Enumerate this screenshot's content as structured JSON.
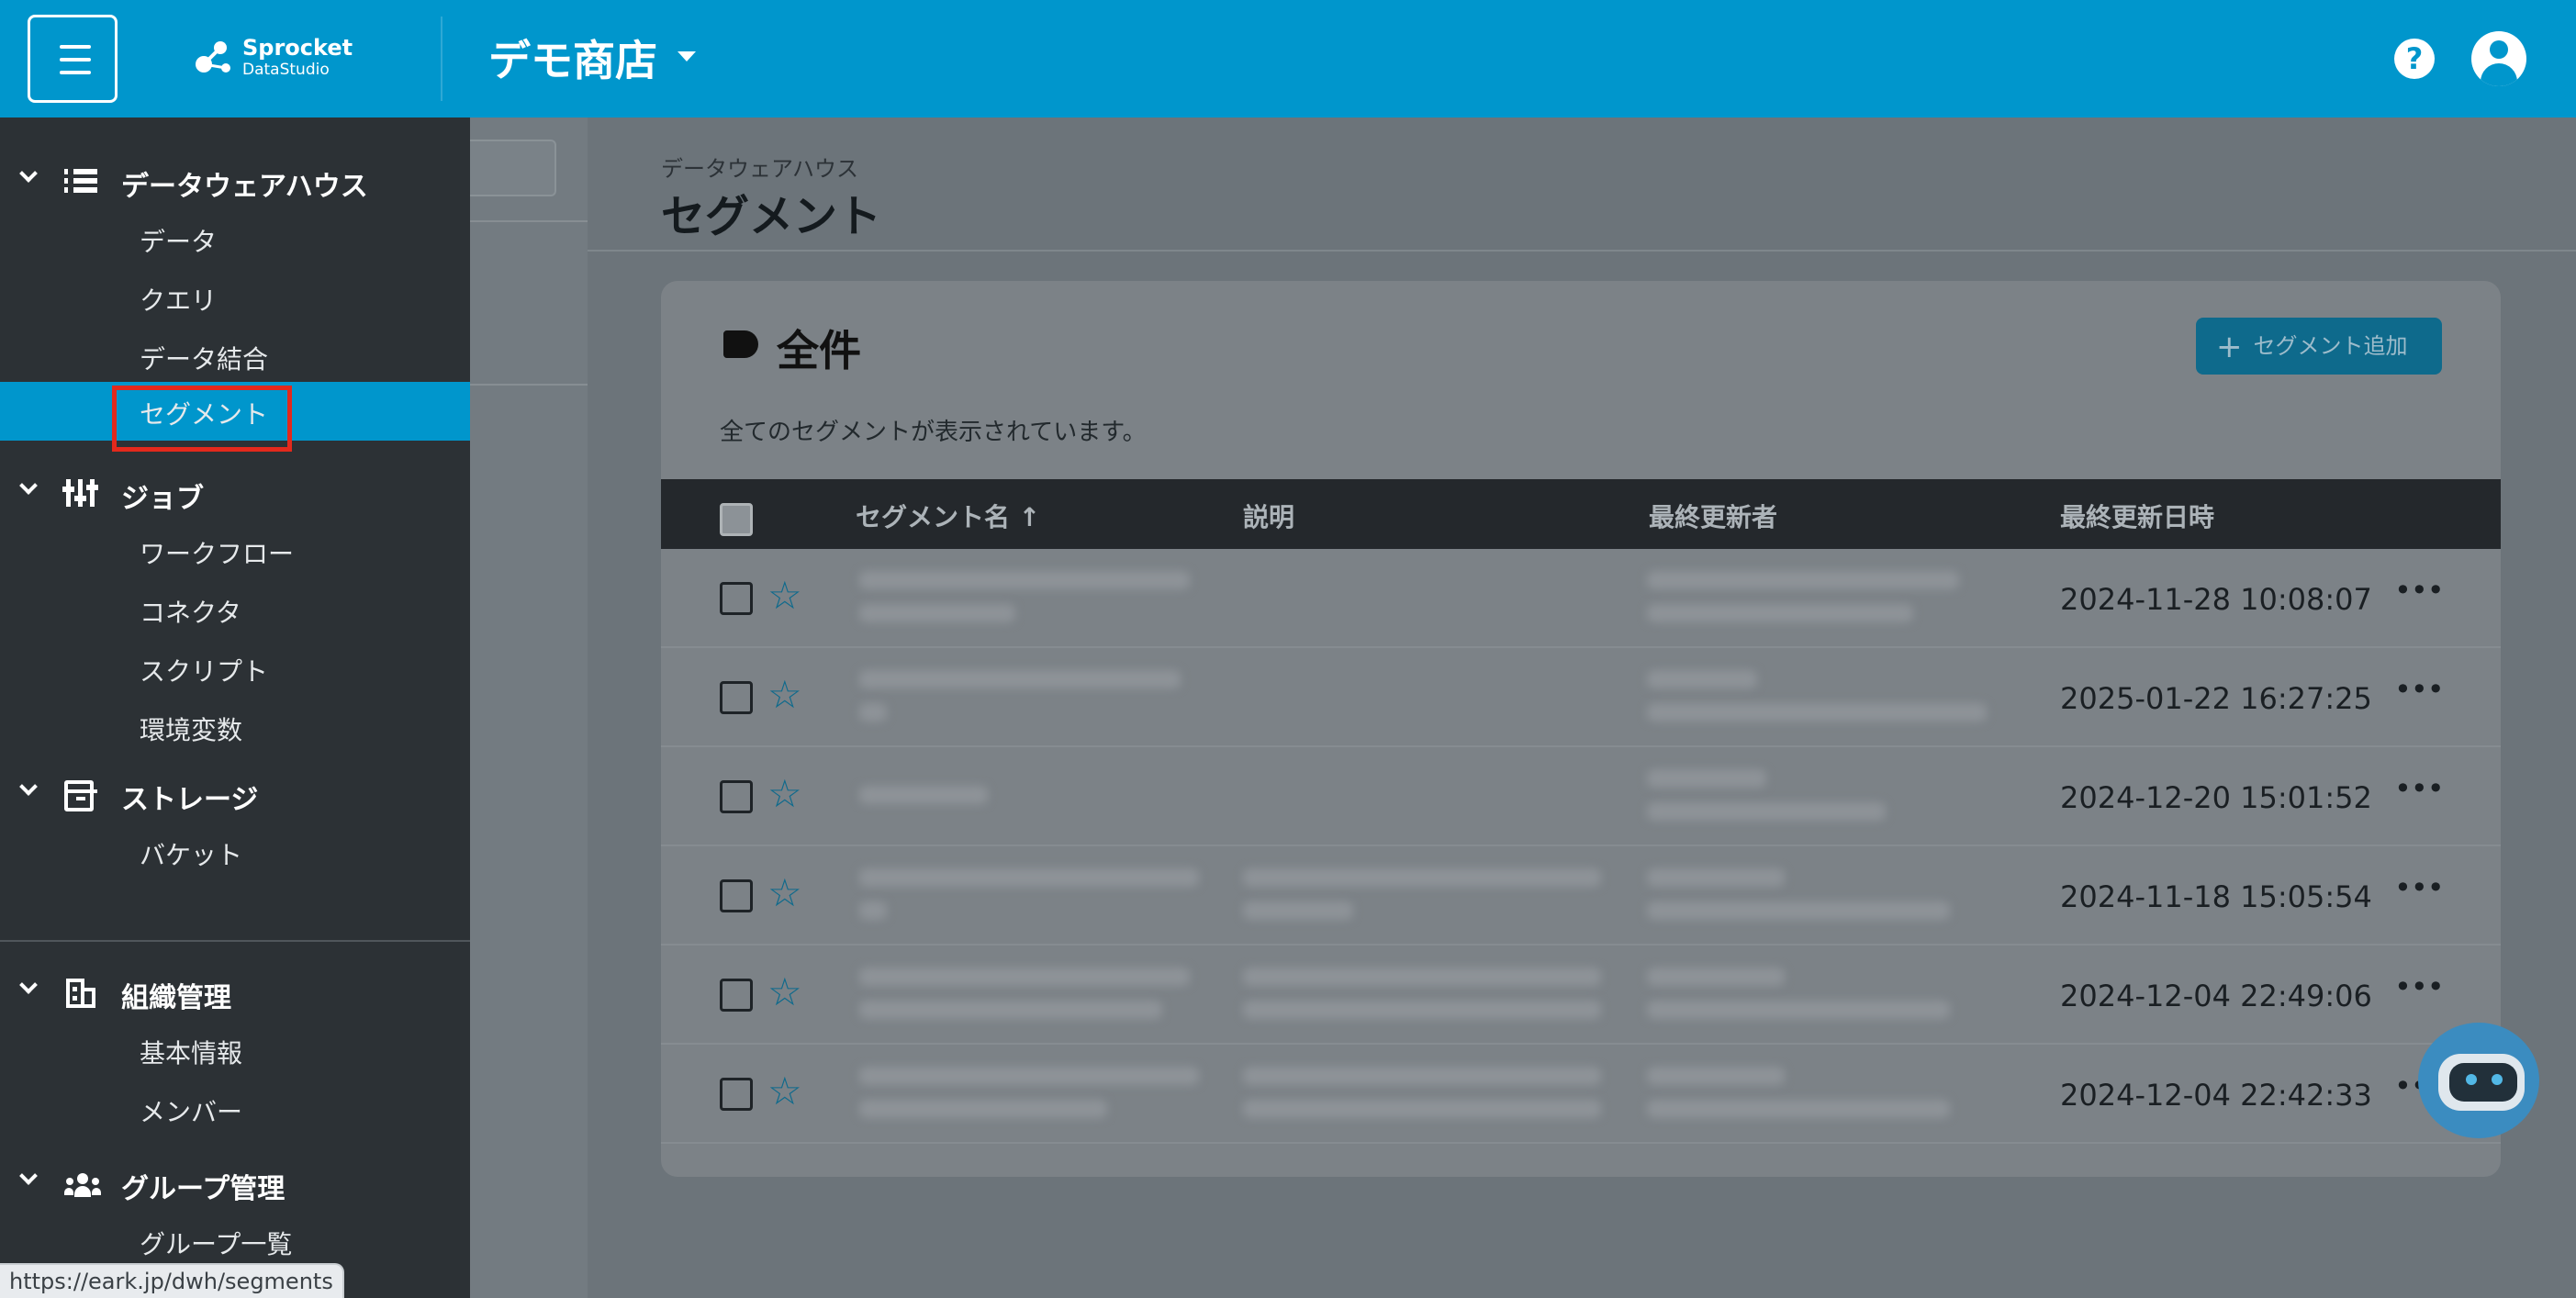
{
  "header": {
    "brand": "Sprocket",
    "brand_sub": "DataStudio",
    "shop_name": "デモ商店",
    "help_icon": "?",
    "accent_color": "#0096cc"
  },
  "sidebar": {
    "sections": [
      {
        "label": "データウェアハウス",
        "icon": "database-icon",
        "items": [
          "データ",
          "クエリ",
          "データ結合",
          "セグメント"
        ]
      },
      {
        "label": "ジョブ",
        "icon": "sliders-icon",
        "items": [
          "ワークフロー",
          "コネクタ",
          "スクリプト",
          "環境変数"
        ]
      },
      {
        "label": "ストレージ",
        "icon": "archive-icon",
        "items": [
          "バケット"
        ]
      },
      {
        "label": "組織管理",
        "icon": "building-icon",
        "items": [
          "基本情報",
          "メンバー"
        ]
      },
      {
        "label": "グループ管理",
        "icon": "group-icon",
        "items": [
          "グループ一覧"
        ]
      }
    ],
    "active_item": "セグメント",
    "highlight_color": "#e3291c"
  },
  "page": {
    "breadcrumb": "データウェアハウス",
    "title": "セグメント"
  },
  "card": {
    "title": "全件",
    "description": "全てのセグメントが表示されています。",
    "add_button": "セグメント追加",
    "add_icon": "+",
    "star_icon": "☆",
    "more_icon": "•••"
  },
  "table": {
    "columns": [
      "セグメント名 ↑",
      "説明",
      "最終更新者",
      "最終更新日時"
    ],
    "rows": [
      {
        "updated_at": "2024-11-28 10:08:07"
      },
      {
        "updated_at": "2025-01-22 16:27:25"
      },
      {
        "updated_at": "2024-12-20 15:01:52"
      },
      {
        "updated_at": "2024-11-18 15:05:54"
      },
      {
        "updated_at": "2024-12-04 22:49:06"
      },
      {
        "updated_at": "2024-12-04 22:42:33"
      }
    ]
  },
  "status_url": "https://eark.jp/dwh/segments"
}
